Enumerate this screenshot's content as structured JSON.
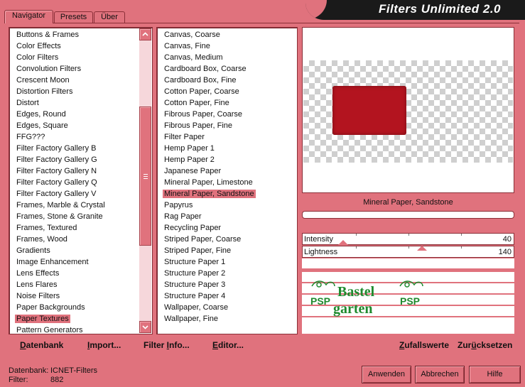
{
  "app": {
    "title": "Filters Unlimited 2.0"
  },
  "tabs": [
    {
      "label": "Navigator",
      "active": true
    },
    {
      "label": "Presets",
      "active": false
    },
    {
      "label": "Über",
      "active": false
    }
  ],
  "categories": {
    "items": [
      "Buttons & Frames",
      "Color Effects",
      "Color Filters",
      "Convolution Filters",
      "Crescent Moon",
      "Distortion Filters",
      "Distort",
      "Edges, Round",
      "Edges, Square",
      "FFG???",
      "Filter Factory Gallery B",
      "Filter Factory Gallery G",
      "Filter Factory Gallery N",
      "Filter Factory Gallery Q",
      "Filter Factory Gallery V",
      "Frames, Marble & Crystal",
      "Frames, Stone & Granite",
      "Frames, Textured",
      "Frames, Wood",
      "Gradients",
      "Image Enhancement",
      "Lens Effects",
      "Lens Flares",
      "Noise Filters",
      "Paper Backgrounds",
      "Paper Textures",
      "Pattern Generators"
    ],
    "selected": "Paper Textures"
  },
  "filters": {
    "items": [
      "Canvas, Coarse",
      "Canvas, Fine",
      "Canvas, Medium",
      "Cardboard Box, Coarse",
      "Cardboard Box, Fine",
      "Cotton Paper, Coarse",
      "Cotton Paper, Fine",
      "Fibrous Paper, Coarse",
      "Fibrous Paper, Fine",
      "Filter Paper",
      "Hemp Paper 1",
      "Hemp Paper 2",
      "Japanese Paper",
      "Mineral Paper, Limestone",
      "Mineral Paper, Sandstone",
      "Papyrus",
      "Rag Paper",
      "Recycling Paper",
      "Striped Paper, Coarse",
      "Striped Paper, Fine",
      "Structure Paper 1",
      "Structure Paper 2",
      "Structure Paper 3",
      "Structure Paper 4",
      "Wallpaper, Coarse",
      "Wallpaper, Fine"
    ],
    "selected": "Mineral Paper, Sandstone"
  },
  "preview": {
    "filter_name": "Mineral Paper, Sandstone",
    "swatch_color": "#b3141f"
  },
  "sliders": [
    {
      "label": "Intensity",
      "value": 40,
      "max": 255
    },
    {
      "label": "Lightness",
      "value": 140,
      "max": 255
    }
  ],
  "logo": {
    "line1": "Bastel",
    "line2": "garten",
    "badge": "PSP"
  },
  "links": [
    {
      "label": "Datenbank",
      "underline_index": 0
    },
    {
      "label": "Import...",
      "underline_index": 0
    },
    {
      "label": "Filter Info...",
      "underline_index": 7
    },
    {
      "label": "Editor...",
      "underline_index": 0
    },
    {
      "label": "Zufallswerte",
      "underline_index": 0
    },
    {
      "label": "Zurücksetzen",
      "underline_index": 3
    }
  ],
  "status": {
    "database_label": "Datenbank:",
    "database_value": "ICNET-Filters",
    "filter_label": "Filter:",
    "filter_value": "882"
  },
  "buttons": {
    "apply": "Anwenden",
    "cancel": "Abbrechen",
    "help": "Hilfe"
  },
  "colors": {
    "background": "#e0727d",
    "accent": "#e0727d",
    "banner": "#1a1a1a",
    "logo_green": "#1f8a2e"
  }
}
